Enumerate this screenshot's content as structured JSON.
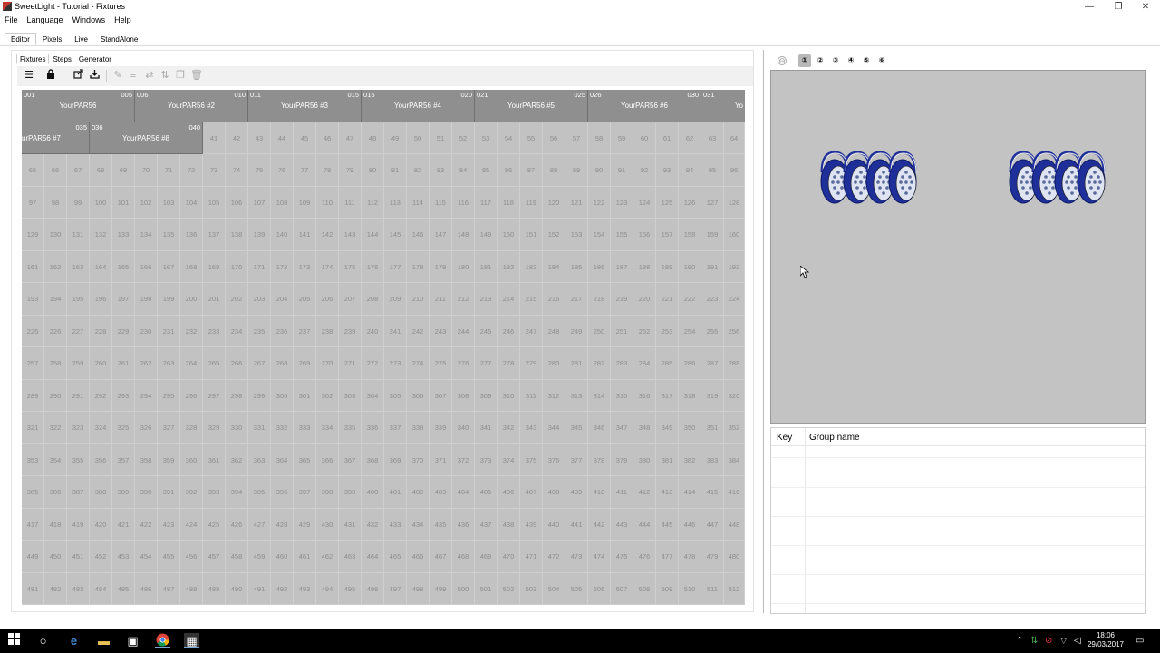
{
  "window": {
    "title": "SweetLight - Tutorial - Fixtures",
    "minimize_glyph": "—",
    "maximize_glyph": "❐",
    "close_glyph": "✕"
  },
  "menu": [
    "File",
    "Language",
    "Windows",
    "Help"
  ],
  "main_tabs": [
    "Editor",
    "Pixels",
    "Live",
    "StandAlone"
  ],
  "sub_tabs": [
    "Fixtures",
    "Steps",
    "Generator"
  ],
  "toolbar_icons": [
    "menu-icon",
    "lock-icon",
    "export-icon",
    "import-icon",
    "edit-icon",
    "align-icon",
    "swap-icon",
    "sort-icon",
    "copy-icon",
    "delete-icon"
  ],
  "grid": {
    "first_free_channel": 41,
    "last_channel": 512,
    "columns": 32
  },
  "fixtures": [
    {
      "name": "YourPAR56",
      "start": "001",
      "end": "005"
    },
    {
      "name": "YourPAR56 #2",
      "start": "006",
      "end": "010"
    },
    {
      "name": "YourPAR56 #3",
      "start": "011",
      "end": "015"
    },
    {
      "name": "YourPAR56 #4",
      "start": "016",
      "end": "020"
    },
    {
      "name": "YourPAR56 #5",
      "start": "021",
      "end": "025"
    },
    {
      "name": "YourPAR56 #6",
      "start": "026",
      "end": "030"
    },
    {
      "name": "Yo",
      "start": "031",
      "end": ""
    },
    {
      "name": "urPAR56 #7",
      "start": "",
      "end": "035"
    },
    {
      "name": "YourPAR56 #8",
      "start": "036",
      "end": "040"
    }
  ],
  "view_buttons": [
    "⊖",
    "①",
    "②",
    "③",
    "④",
    "⑤",
    "⑥"
  ],
  "group_table": {
    "col_key": "Key",
    "col_name": "Group name"
  },
  "taskbar": {
    "time": "18:06",
    "date": "29/03/2017"
  },
  "colors": {
    "grid_bg": "#c2c2c2",
    "fixture_bg": "#8f8f8f",
    "preview_bg": "#c3c3c3",
    "par_blue": "#1f2f9a"
  }
}
